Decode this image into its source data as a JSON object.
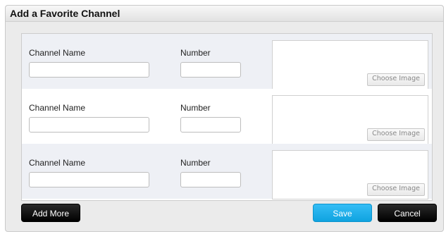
{
  "dialog": {
    "title": "Add a Favorite Channel"
  },
  "rows": [
    {
      "name_label": "Channel Name",
      "number_label": "Number",
      "name_value": "",
      "number_value": "",
      "choose_label": "Choose Image"
    },
    {
      "name_label": "Channel Name",
      "number_label": "Number",
      "name_value": "",
      "number_value": "",
      "choose_label": "Choose Image"
    },
    {
      "name_label": "Channel Name",
      "number_label": "Number",
      "name_value": "",
      "number_value": "",
      "choose_label": "Choose Image"
    }
  ],
  "buttons": {
    "add_more": "Add More",
    "save": "Save",
    "cancel": "Cancel"
  },
  "colors": {
    "save_accent": "#1fb0ee",
    "row_shade": "#eef0f5",
    "dark_button": "#000000"
  }
}
